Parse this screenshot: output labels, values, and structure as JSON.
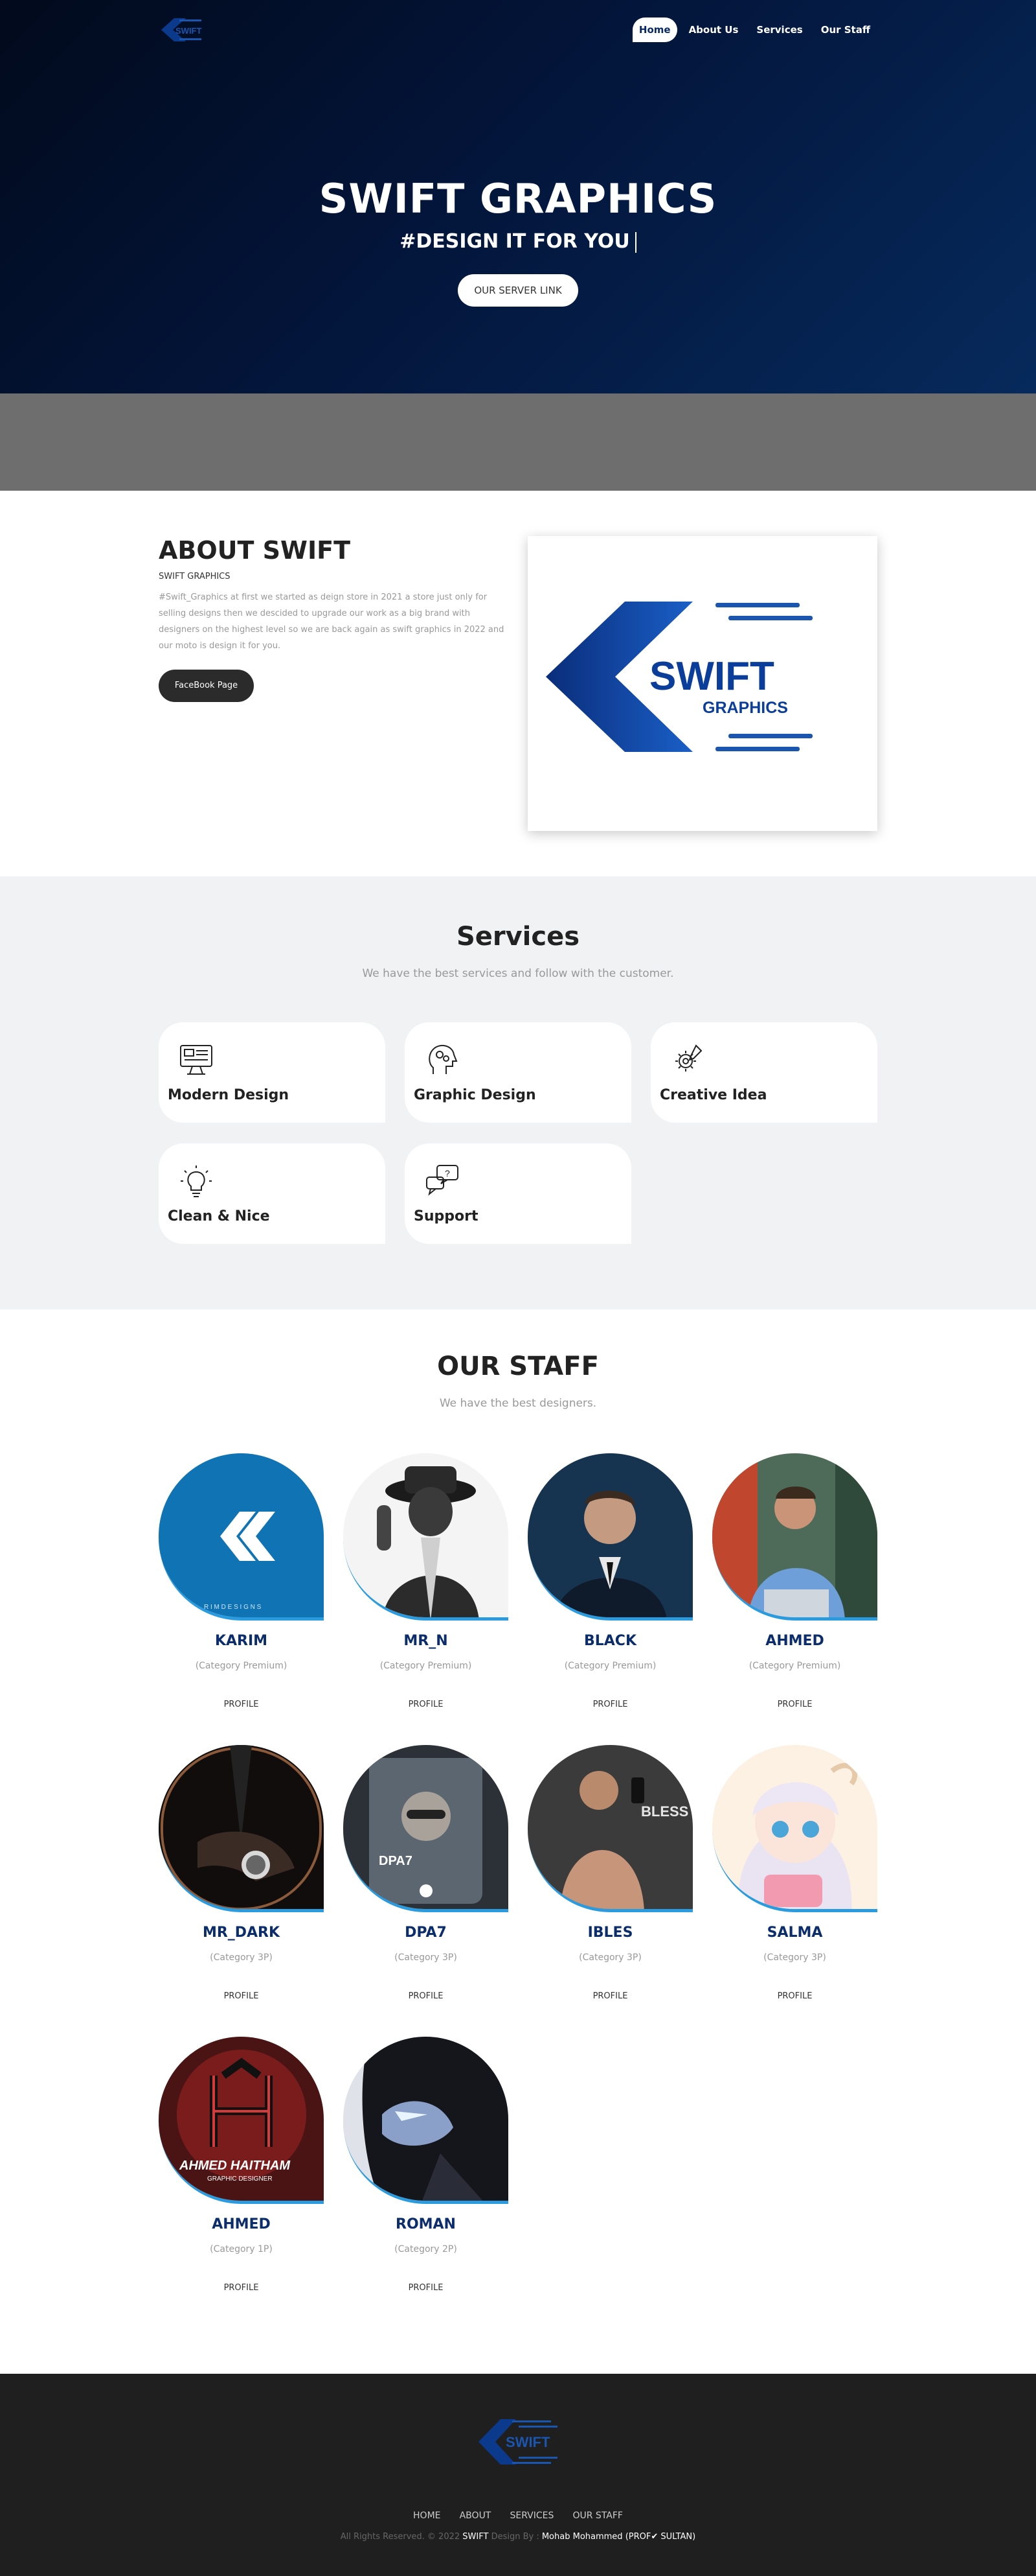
{
  "nav": {
    "items": [
      {
        "label": "Home",
        "active": true
      },
      {
        "label": "About Us"
      },
      {
        "label": "Services"
      },
      {
        "label": "Our Staff"
      }
    ]
  },
  "hero": {
    "title": "SWIFT GRAPHICS",
    "subtitle": "#DESIGN IT FOR YOU",
    "button": "OUR SERVER LINK"
  },
  "about": {
    "title": "ABOUT SWIFT",
    "subtitle": "SWIFT GRAPHICS",
    "text": "#Swift_Graphics at first we started as deign store in 2021 a store just only for selling designs then we descided to upgrade our work as a big brand with designers on the highest level so we are back again as swift graphics in 2022 and our moto is design it for you.",
    "button": "FaceBook Page"
  },
  "logo": {
    "word": "SWIFT",
    "sub": "GRAPHICS"
  },
  "services": {
    "title": "Services",
    "description": "We have the best services and follow with the customer.",
    "items": [
      {
        "label": "Modern Design",
        "icon": "monitor-design-icon"
      },
      {
        "label": "Graphic Design",
        "icon": "head-gears-icon"
      },
      {
        "label": "Creative Idea",
        "icon": "gear-pencil-icon"
      },
      {
        "label": "Clean & Nice",
        "icon": "lightbulb-icon"
      },
      {
        "label": "Support",
        "icon": "support-chat-icon"
      }
    ]
  },
  "staff": {
    "title": "OUR STAFF",
    "description": "We have the best designers.",
    "profile_label": "PROFILE",
    "members": [
      {
        "name": "KARIM",
        "category": "(Category Premium)"
      },
      {
        "name": "MR_N",
        "category": "(Category Premium)"
      },
      {
        "name": "BLACK",
        "category": "(Category Premium)"
      },
      {
        "name": "AHMED",
        "category": "(Category Premium)"
      },
      {
        "name": "MR_DARK",
        "category": "(Category 3P)"
      },
      {
        "name": "DPA7",
        "category": "(Category 3P)"
      },
      {
        "name": "IBLES",
        "category": "(Category 3P)"
      },
      {
        "name": "SALMA",
        "category": "(Category 3P)"
      },
      {
        "name": "AHMED",
        "category": "(Category 1P)"
      },
      {
        "name": "ROMAN",
        "category": "(Category 2P)"
      }
    ],
    "avatar_text": {
      "karim_brand": "R I M   D E S I G N S",
      "dpa7": "DPA7",
      "ibles": "BLESS",
      "ahmed_haitham": "AHMED HAITHAM",
      "ahmed_haitham_sub": "GRAPHIC DESIGNER"
    }
  },
  "footer": {
    "links": [
      "HOME",
      "ABOUT",
      "SERVICES",
      "OUR STAFF"
    ],
    "copy_prefix": "All Rights Reserved. © 2022",
    "brand": "SWIFT",
    "design_by": "Design By :",
    "author": "Mohab Mohammed (PROF✔ SULTAN)"
  },
  "colors": {
    "navy": "#0b2d6b",
    "accent_blue": "#2b9be0",
    "dark": "#2b2b2b"
  }
}
